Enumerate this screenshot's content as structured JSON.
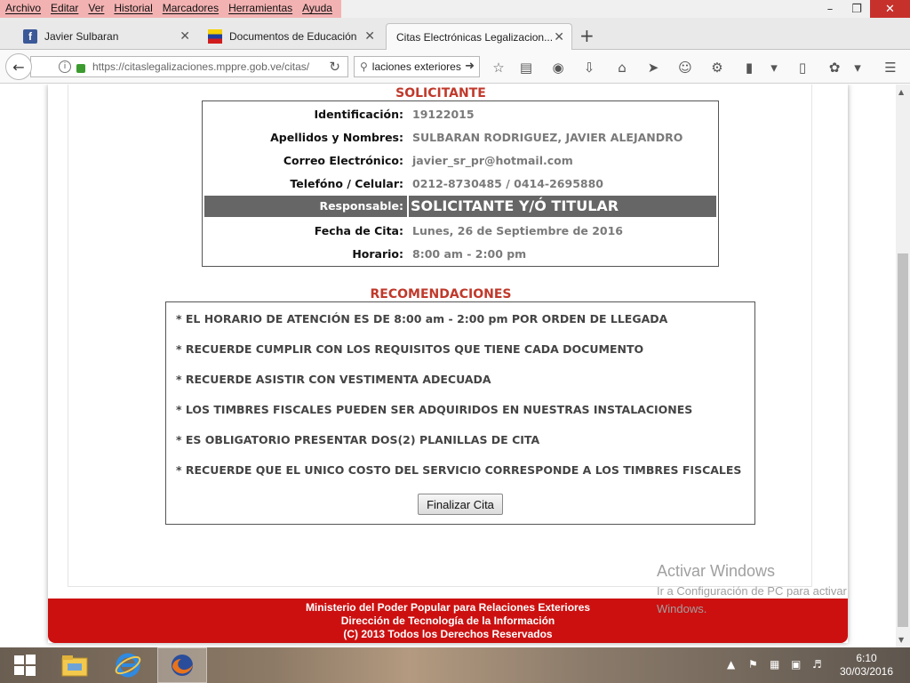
{
  "browser": {
    "menu": [
      "Archivo",
      "Editar",
      "Ver",
      "Historial",
      "Marcadores",
      "Herramientas",
      "Ayuda"
    ],
    "tabs": [
      {
        "label": "Javier Sulbaran"
      },
      {
        "label": "Documentos de Educación"
      },
      {
        "label": "Citas Electrónicas Legalizacion..."
      }
    ],
    "url": "https://citaslegalizaciones.mppre.gob.ve/citas/",
    "search_value": "laciones exteriores"
  },
  "solicitante": {
    "title": "SOLICITANTE",
    "rows": [
      {
        "label": "Identificación:",
        "value": "19122015"
      },
      {
        "label": "Apellidos y Nombres:",
        "value": "SULBARAN RODRIGUEZ, JAVIER ALEJANDRO"
      },
      {
        "label": "Correo Electrónico:",
        "value": "javier_sr_pr@hotmail.com"
      },
      {
        "label": "Telefóno / Celular:",
        "value": "0212-8730485 / 0414-2695880"
      },
      {
        "label": "Responsable:",
        "value": "SOLICITANTE Y/Ó TITULAR"
      },
      {
        "label": "Fecha de Cita:",
        "value": "Lunes, 26 de Septiembre de 2016"
      },
      {
        "label": "Horario:",
        "value": "8:00 am - 2:00 pm"
      }
    ]
  },
  "recomendaciones": {
    "title": "RECOMENDACIONES",
    "items": [
      "* EL HORARIO DE ATENCIÓN ES DE 8:00 am - 2:00 pm POR ORDEN DE LLEGADA",
      "* RECUERDE CUMPLIR CON LOS REQUISITOS QUE TIENE CADA DOCUMENTO",
      "* RECUERDE ASISTIR CON VESTIMENTA ADECUADA",
      "* LOS TIMBRES FISCALES PUEDEN SER ADQUIRIDOS EN NUESTRAS INSTALACIONES",
      "* ES OBLIGATORIO PRESENTAR DOS(2) PLANILLAS DE CITA",
      "* RECUERDE QUE EL UNICO COSTO DEL SERVICIO CORRESPONDE A LOS TIMBRES FISCALES"
    ],
    "button": "Finalizar Cita"
  },
  "footer": {
    "line1": "Ministerio del Poder Popular para Relaciones Exteriores",
    "line2": "Dirección de Tecnología de la Información",
    "line3": "(C) 2013 Todos los Derechos Reservados"
  },
  "watermark": {
    "line1": "Activar Windows",
    "line2": "Ir a Configuración de PC para activar Windows."
  },
  "taskbar": {
    "time": "6:10",
    "date": "30/03/2016"
  },
  "colors": {
    "accent_red": "#cc1010",
    "section_title": "#c0392b",
    "highlight_row": "#666666"
  }
}
